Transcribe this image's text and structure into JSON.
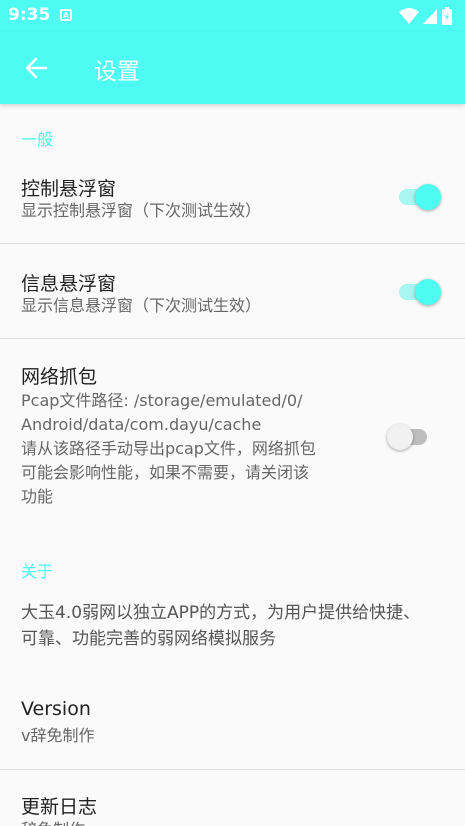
{
  "status_bar": {
    "time": "9:35",
    "notification_icon": "A",
    "icons": [
      "wifi-icon",
      "signal-icon",
      "battery-icon"
    ]
  },
  "toolbar": {
    "back_icon": "arrow-left-icon",
    "title": "设置"
  },
  "colors": {
    "accent": "#4dfbf3",
    "background": "#fafafa",
    "divider": "#dcdcdc",
    "title_text": "#222222",
    "summary_text": "#666666"
  },
  "categories": {
    "general": "一般",
    "about": "关于"
  },
  "prefs": {
    "float_control": {
      "title": "控制悬浮窗",
      "summary": "显示控制悬浮窗（下次测试生效）",
      "enabled": true
    },
    "float_info": {
      "title": "信息悬浮窗",
      "summary": "显示信息悬浮窗（下次测试生效）",
      "enabled": true
    },
    "capture": {
      "title": "网络抓包",
      "summary_lines": [
        "Pcap文件路径: /storage/emulated/0/",
        "Android/data/com.dayu/cache",
        "请从该路径手动导出pcap文件，网络抓包",
        "可能会影响性能，如果不需要，请关闭该",
        "功能"
      ],
      "enabled": false
    }
  },
  "about": {
    "description_lines": [
      "大玉4.0弱网以独立APP的方式，为用户提供给快捷、",
      "可靠、功能完善的弱网络模拟服务"
    ],
    "version": {
      "title": "Version",
      "summary": "v辞免制作"
    },
    "changelog": {
      "title": "更新日志",
      "summary": "辞免制作"
    }
  }
}
